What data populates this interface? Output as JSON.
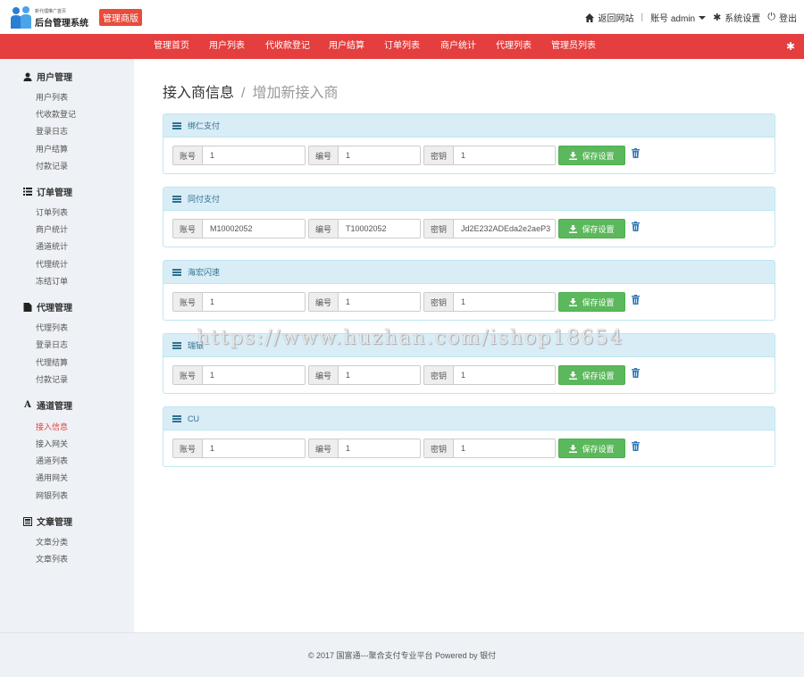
{
  "brand": {
    "tagline": "新代理推广首页",
    "title": "后台管理系统",
    "badge": "管理商版"
  },
  "topbar": {
    "home": "返回网站",
    "account": "账号 admin",
    "settings": "系统设置",
    "logout": "登出"
  },
  "nav": [
    "管理首页",
    "用户列表",
    "代收款登记",
    "用户结算",
    "订单列表",
    "商户统计",
    "代理列表",
    "管理员列表"
  ],
  "sidebar": {
    "groups": [
      {
        "title": "用户管理",
        "icon": "user-icon",
        "items": [
          "用户列表",
          "代收款登记",
          "登录日志",
          "用户结算",
          "付款记录"
        ]
      },
      {
        "title": "订单管理",
        "icon": "list-icon",
        "items": [
          "订单列表",
          "商户统计",
          "通道统计",
          "代理统计",
          "冻结订单"
        ]
      },
      {
        "title": "代理管理",
        "icon": "file-icon",
        "items": [
          "代理列表",
          "登录日志",
          "代理结算",
          "付款记录"
        ]
      },
      {
        "title": "通道管理",
        "icon": "font-icon",
        "items": [
          "接入信息",
          "接入网关",
          "通道列表",
          "通用网关",
          "网银列表"
        ]
      },
      {
        "title": "文章管理",
        "icon": "news-icon",
        "items": [
          "文章分类",
          "文章列表"
        ]
      }
    ],
    "active": "接入信息"
  },
  "breadcrumb": {
    "title": "接入商信息",
    "sub": "增加新接入商"
  },
  "field_labels": {
    "account": "账号",
    "number": "编号",
    "key": "密钥"
  },
  "save_label": "保存设置",
  "panels": [
    {
      "title": "绑仁支付",
      "account": "1",
      "number": "1",
      "key": "1"
    },
    {
      "title": "同付支付",
      "account": "M10002052",
      "number": "T10002052",
      "key": "Jd2E232ADEda2e2aeP3"
    },
    {
      "title": "海宏闪速",
      "account": "1",
      "number": "1",
      "key": "1"
    },
    {
      "title": "瑞银",
      "account": "1",
      "number": "1",
      "key": "1"
    },
    {
      "title": "CU",
      "account": "1",
      "number": "1",
      "key": "1"
    }
  ],
  "watermark": "https://www.huzhan.com/ishop18654",
  "footer": "© 2017  国富通---聚合支付专业平台 Powered by 银付",
  "colors": {
    "primary_red": "#e43e3e",
    "success": "#5cb85c",
    "panel_header": "#d9edf7",
    "sidebar_bg": "#eef1f5"
  }
}
